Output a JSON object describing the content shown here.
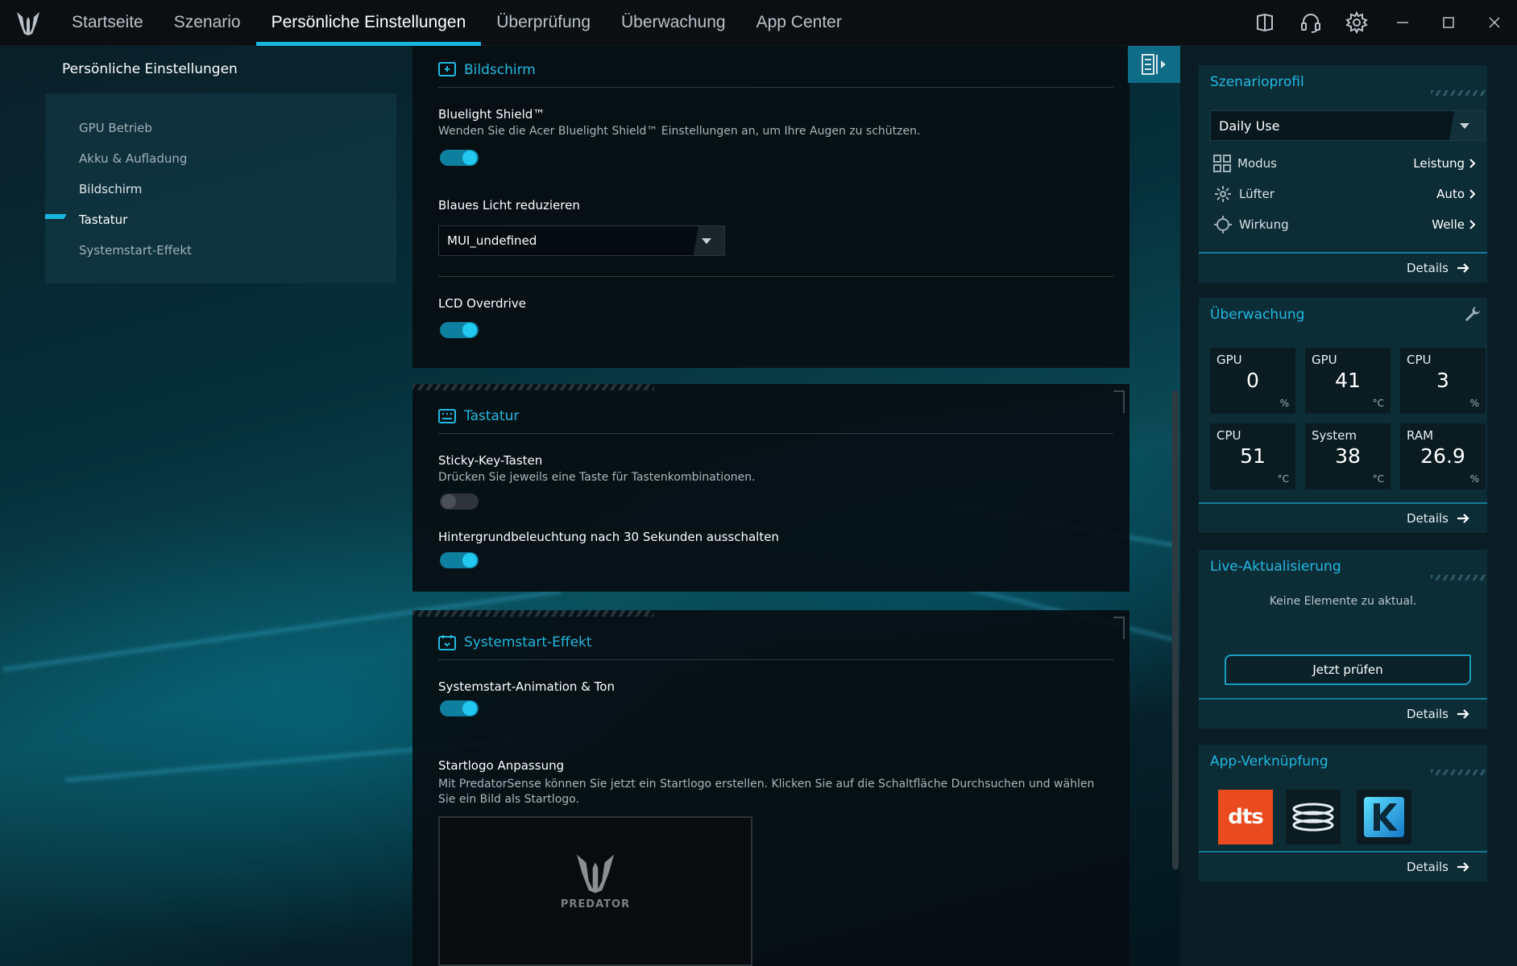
{
  "nav": {
    "items": [
      "Startseite",
      "Szenario",
      "Persönliche Einstellungen",
      "Überprüfung",
      "Überwachung",
      "App Center"
    ],
    "active_index": 2
  },
  "sidebar": {
    "title": "Persönliche Einstellungen",
    "items": [
      "GPU Betrieb",
      "Akku & Aufladung",
      "Bildschirm",
      "Tastatur",
      "Systemstart-Effekt"
    ],
    "active_index": 3
  },
  "screen_section": {
    "title": "Bildschirm",
    "bluelight_title": "Bluelight Shield™",
    "bluelight_desc": "Wenden Sie die Acer Bluelight Shield™ Einstellungen an, um Ihre Augen zu schützen.",
    "bluelight_on": true,
    "reduce_title": "Blaues Licht reduzieren",
    "reduce_value": "MUI_undefined",
    "overdrive_title": "LCD Overdrive",
    "overdrive_on": true
  },
  "keyboard_section": {
    "title": "Tastatur",
    "sticky_title": "Sticky-Key-Tasten",
    "sticky_desc": "Drücken Sie jeweils eine Taste für Tastenkombinationen.",
    "sticky_on": false,
    "backlight_title": "Hintergrundbeleuchtung nach 30 Sekunden ausschalten",
    "backlight_on": true
  },
  "boot_section": {
    "title": "Systemstart-Effekt",
    "anim_title": "Systemstart-Animation & Ton",
    "anim_on": true,
    "logo_title": "Startlogo Anpassung",
    "logo_desc": "Mit PredatorSense können Sie jetzt ein Startlogo erstellen. Klicken Sie auf die Schaltfläche Durchsuchen und wählen Sie ein Bild als Startlogo.",
    "logo_text": "PREDATOR"
  },
  "profile": {
    "title": "Szenarioprofil",
    "selected": "Daily Use",
    "rows": [
      {
        "label": "Modus",
        "value": "Leistung",
        "icon": "grid-icon"
      },
      {
        "label": "Lüfter",
        "value": "Auto",
        "icon": "fan-icon"
      },
      {
        "label": "Wirkung",
        "value": "Welle",
        "icon": "effect-icon"
      }
    ],
    "details": "Details"
  },
  "monitor": {
    "title": "Überwachung",
    "tiles": [
      {
        "label": "GPU",
        "value": "0",
        "unit": "%"
      },
      {
        "label": "GPU",
        "value": "41",
        "unit": "°C"
      },
      {
        "label": "CPU",
        "value": "3",
        "unit": "%"
      },
      {
        "label": "CPU",
        "value": "51",
        "unit": "°C"
      },
      {
        "label": "System",
        "value": "38",
        "unit": "°C"
      },
      {
        "label": "RAM",
        "value": "26.9",
        "unit": "%"
      }
    ],
    "details": "Details"
  },
  "live_update": {
    "title": "Live-Aktualisierung",
    "status": "Keine Elemente zu aktual.",
    "button": "Jetzt prüfen",
    "details": "Details"
  },
  "app_links": {
    "title": "App-Verknüpfung",
    "apps": [
      "dts",
      "Nahimic",
      "Killer"
    ],
    "details": "Details"
  },
  "colors": {
    "accent": "#18b6df",
    "panel": "#060e12",
    "card": "#0c2c36"
  }
}
